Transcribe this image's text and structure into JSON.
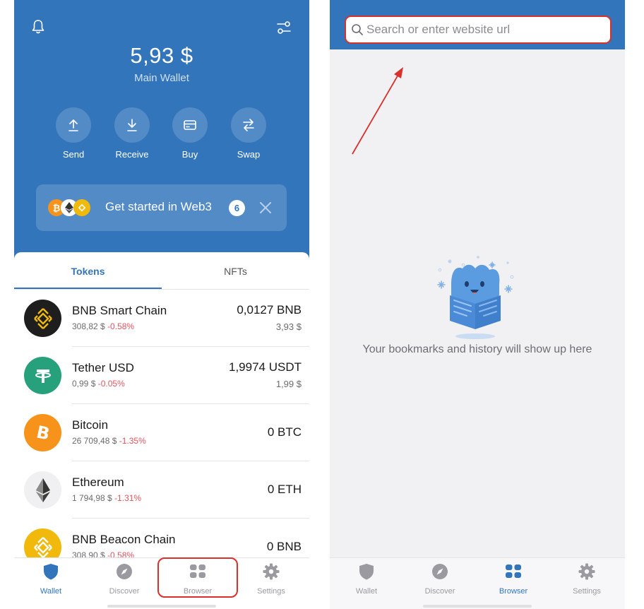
{
  "wallet": {
    "balance": "5,93 $",
    "wallet_name": "Main Wallet",
    "actions": [
      {
        "label": "Send",
        "icon": "arrow-up-icon"
      },
      {
        "label": "Receive",
        "icon": "arrow-down-icon"
      },
      {
        "label": "Buy",
        "icon": "card-icon"
      },
      {
        "label": "Swap",
        "icon": "swap-icon"
      }
    ],
    "banner": {
      "text": "Get started in Web3",
      "badge": "6"
    },
    "tabs": [
      "Tokens",
      "NFTs"
    ],
    "tokens": [
      {
        "name": "BNB Smart Chain",
        "price": "308,82 $",
        "change": "-0.58%",
        "amount": "0,0127 BNB",
        "fiat": "3,93 $"
      },
      {
        "name": "Tether USD",
        "price": "0,99 $",
        "change": "-0.05%",
        "amount": "1,9974 USDT",
        "fiat": "1,99 $"
      },
      {
        "name": "Bitcoin",
        "price": "26 709,48 $",
        "change": "-1.35%",
        "amount": "0 BTC",
        "fiat": ""
      },
      {
        "name": "Ethereum",
        "price": "1 794,98 $",
        "change": "-1.31%",
        "amount": "0 ETH",
        "fiat": ""
      },
      {
        "name": "BNB Beacon Chain",
        "price": "308,90 $",
        "change": "-0.58%",
        "amount": "0 BNB",
        "fiat": ""
      }
    ]
  },
  "nav": {
    "items": [
      "Wallet",
      "Discover",
      "Browser",
      "Settings"
    ]
  },
  "browser": {
    "search_placeholder": "Search or enter website url",
    "empty_message": "Your bookmarks and history will show up here"
  },
  "colors": {
    "brand_blue": "#3375bb",
    "negative_change": "#e2555d",
    "highlight_red": "#d9302c"
  }
}
